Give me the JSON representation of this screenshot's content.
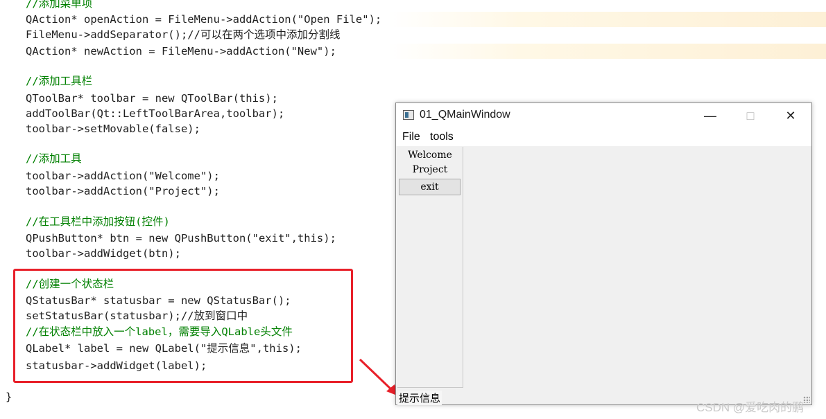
{
  "code": {
    "lines": [
      "//添加菜单项",
      "QAction* openAction = FileMenu->addAction(\"Open File\");",
      "FileMenu->addSeparator();//可以在两个选项中添加分割线",
      "QAction* newAction = FileMenu->addAction(\"New\");",
      "//添加工具栏",
      "QToolBar* toolbar = new QToolBar(this);",
      "addToolBar(Qt::LeftToolBarArea,toolbar);",
      "toolbar->setMovable(false);",
      "//添加工具",
      "toolbar->addAction(\"Welcome\");",
      "toolbar->addAction(\"Project\");",
      "//在工具栏中添加按钮(控件)",
      "QPushButton* btn = new QPushButton(\"exit\",this);",
      "toolbar->addWidget(btn);",
      "//创建一个状态栏",
      "QStatusBar* statusbar = new QStatusBar();",
      "setStatusBar(statusbar);//放到窗口中",
      "//在状态栏中放入一个label，需要导入QLable头文件",
      "QLabel* label = new QLabel(\"提示信息\",this);",
      "statusbar->addWidget(label);",
      "}"
    ]
  },
  "window": {
    "title": "01_QMainWindow",
    "menus": [
      "File",
      "tools"
    ],
    "toolbar_actions": [
      "Welcome",
      "Project"
    ],
    "toolbar_button": "exit",
    "status_label": "提示信息"
  },
  "watermark": "CSDN @爱吃肉的鹏",
  "colors": {
    "highlight_box": "#e8202a",
    "comment": "#008000",
    "function": "#00677c",
    "type": "#80772a"
  }
}
